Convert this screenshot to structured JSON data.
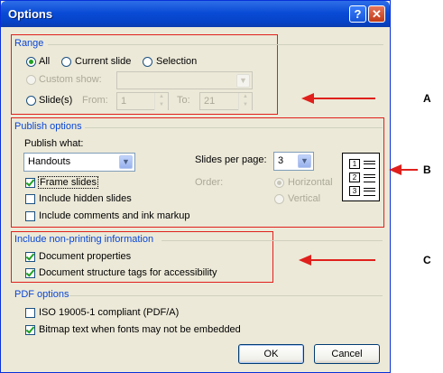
{
  "window": {
    "title": "Options",
    "help_glyph": "?",
    "close_glyph": "✕"
  },
  "range": {
    "label": "Range",
    "all": "All",
    "current_slide": "Current slide",
    "selection": "Selection",
    "custom_show": "Custom show:",
    "slides": "Slide(s)",
    "from_label": "From:",
    "from_value": "1",
    "to_label": "To:",
    "to_value": "21"
  },
  "publish": {
    "label": "Publish options",
    "publish_what_label": "Publish what:",
    "publish_what_value": "Handouts",
    "slides_per_page_label": "Slides per page:",
    "slides_per_page_value": "3",
    "order_label": "Order:",
    "horizontal": "Horizontal",
    "vertical": "Vertical",
    "frame_slides": "Frame slides",
    "include_hidden": "Include hidden slides",
    "include_comments": "Include comments and ink markup",
    "preview_numbers": [
      "1",
      "2",
      "3"
    ]
  },
  "nonprinting": {
    "label": "Include non-printing information",
    "doc_props": "Document properties",
    "doc_tags": "Document structure tags for accessibility"
  },
  "pdf": {
    "label": "PDF options",
    "iso": "ISO 19005-1 compliant (PDF/A)",
    "bitmap": "Bitmap text when fonts may not be embedded"
  },
  "buttons": {
    "ok": "OK",
    "cancel": "Cancel"
  },
  "callouts": {
    "a": "A",
    "b": "B",
    "c": "C"
  },
  "colors": {
    "accent_red": "#e0201c",
    "group_blue": "#0a46d6",
    "check_green": "#21a121"
  }
}
